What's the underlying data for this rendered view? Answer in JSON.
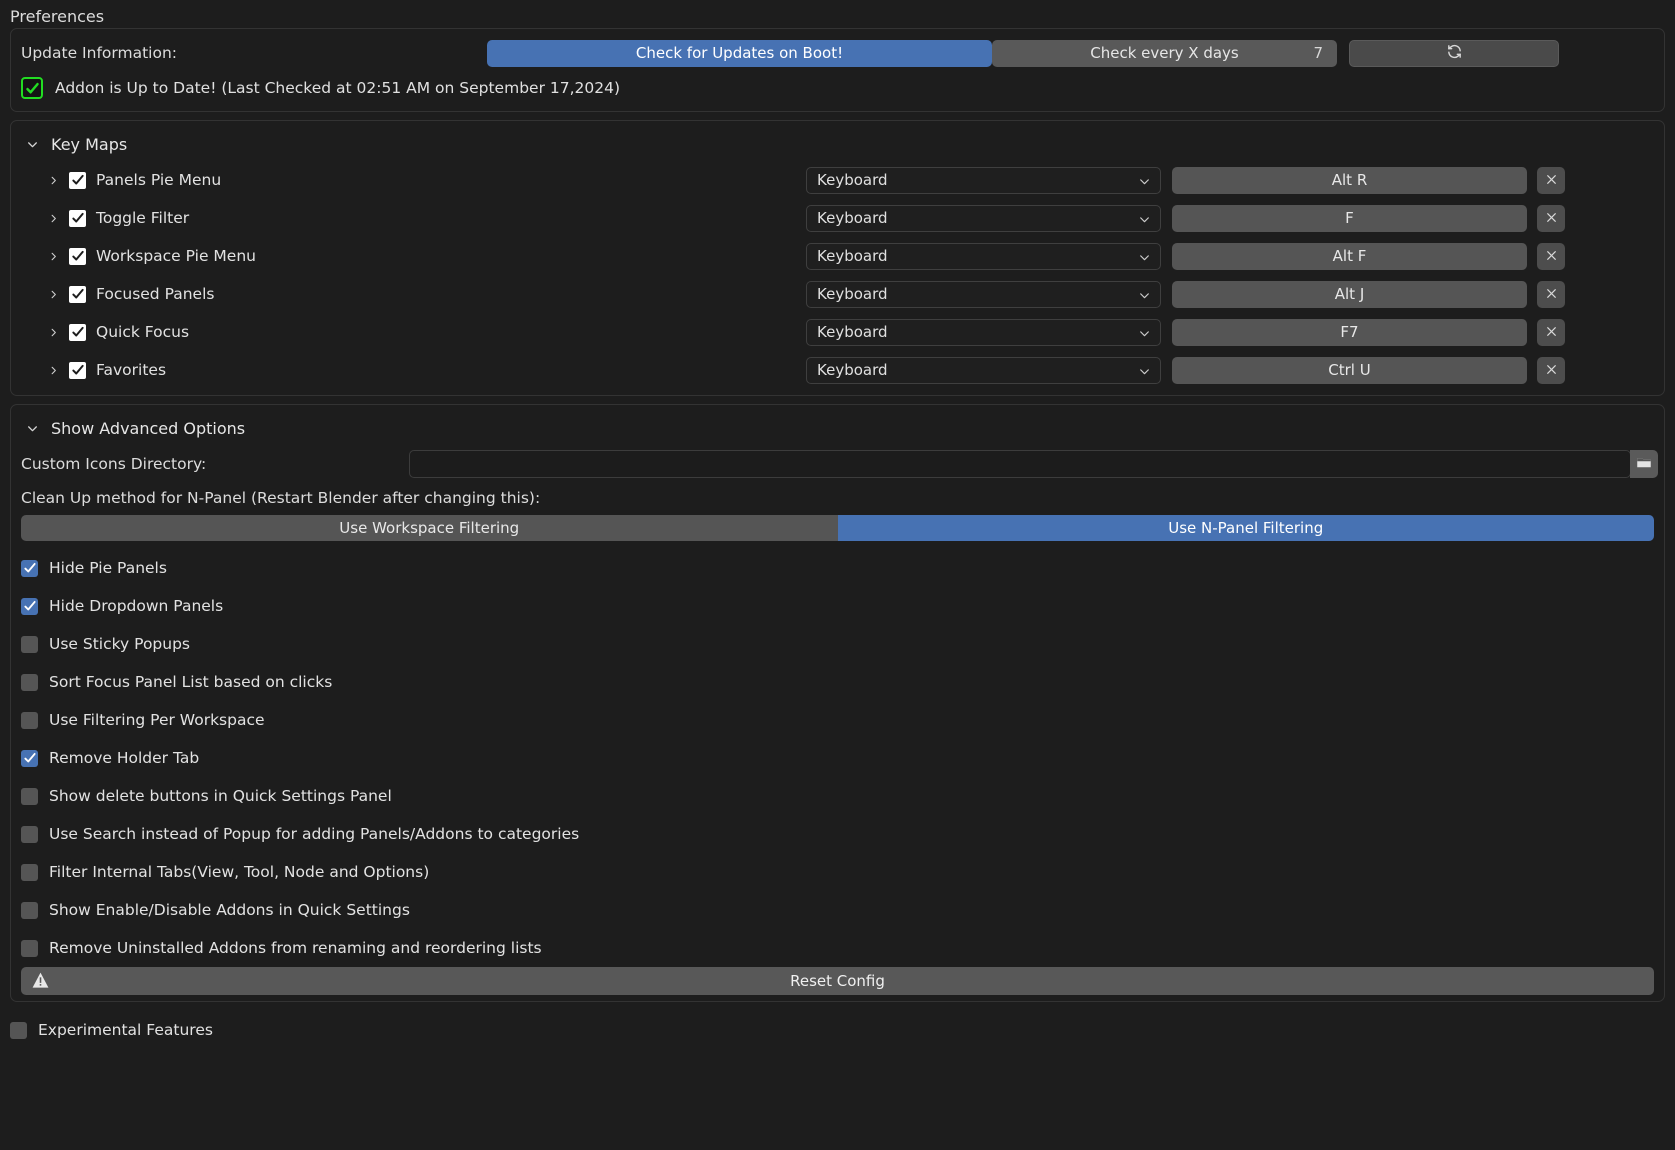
{
  "window": {
    "title": "Preferences"
  },
  "update": {
    "label": "Update Information:",
    "check_on_boot_label": "Check for Updates on Boot!",
    "check_every_label": "Check every X days",
    "check_every_value": "7",
    "refresh_icon": "refresh-icon",
    "status_icon": "green-check-icon",
    "status_text": "Addon is Up to Date! (Last Checked at 02:51 AM on September 17,2024)",
    "accent_blue": "#4772b3",
    "status_green": "#22dd22"
  },
  "key_maps": {
    "section_label": "Key Maps",
    "expanded": true,
    "rows": [
      {
        "label": "Panels Pie Menu",
        "enabled": true,
        "device": "Keyboard",
        "key": "Alt R",
        "remove_label": "x"
      },
      {
        "label": "Toggle Filter",
        "enabled": true,
        "device": "Keyboard",
        "key": "F",
        "remove_label": "x"
      },
      {
        "label": "Workspace Pie Menu",
        "enabled": true,
        "device": "Keyboard",
        "key": "Alt F",
        "remove_label": "x"
      },
      {
        "label": "Focused Panels",
        "enabled": true,
        "device": "Keyboard",
        "key": "Alt J",
        "remove_label": "x"
      },
      {
        "label": "Quick Focus",
        "enabled": true,
        "device": "Keyboard",
        "key": "F7",
        "remove_label": "x"
      },
      {
        "label": "Favorites",
        "enabled": true,
        "device": "Keyboard",
        "key": "Ctrl U",
        "remove_label": "x"
      }
    ]
  },
  "advanced": {
    "section_label": "Show Advanced Options",
    "custom_icons_label": "Custom Icons Directory:",
    "custom_icons_value": "",
    "custom_icons_placeholder": "",
    "folder_icon": "folder-icon",
    "cleanup_note": "Clean Up method for N-Panel (Restart Blender after changing this):",
    "cleanup_options": [
      {
        "label": "Use Workspace Filtering",
        "active": false
      },
      {
        "label": "Use N-Panel Filtering",
        "active": true
      }
    ],
    "options": [
      {
        "label": "Hide Pie Panels",
        "checked": true
      },
      {
        "label": "Hide Dropdown Panels",
        "checked": true
      },
      {
        "label": "Use Sticky Popups",
        "checked": false
      },
      {
        "label": "Sort Focus Panel List based on clicks",
        "checked": false
      },
      {
        "label": "Use Filtering Per Workspace",
        "checked": false
      },
      {
        "label": "Remove Holder Tab",
        "checked": true
      },
      {
        "label": "Show delete buttons in Quick Settings Panel",
        "checked": false
      },
      {
        "label": "Use Search instead of Popup for adding Panels/Addons to categories",
        "checked": false
      },
      {
        "label": "Filter Internal Tabs(View, Tool, Node and Options)",
        "checked": false
      },
      {
        "label": "Show Enable/Disable Addons in Quick Settings",
        "checked": false
      },
      {
        "label": "Remove Uninstalled Addons from renaming and reordering lists",
        "checked": false
      }
    ],
    "reset_label": "Reset Config",
    "reset_icon": "warning-icon"
  },
  "footer": {
    "experimental_label": "Experimental Features",
    "experimental_checked": false
  }
}
